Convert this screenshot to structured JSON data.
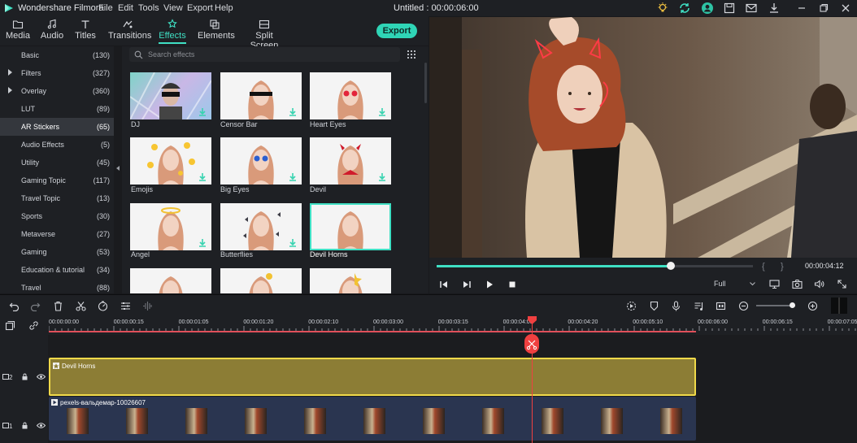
{
  "app": {
    "name": "Wondershare Filmora",
    "window_title": "Untitled : 00:00:06:00"
  },
  "menu": [
    "File",
    "Edit",
    "Tools",
    "View",
    "Export",
    "Help"
  ],
  "module_tabs": [
    {
      "label": "Media",
      "icon": "folder-icon"
    },
    {
      "label": "Audio",
      "icon": "music-note-icon"
    },
    {
      "label": "Titles",
      "icon": "text-icon"
    },
    {
      "label": "Transitions",
      "icon": "transition-icon"
    },
    {
      "label": "Effects",
      "icon": "effects-icon",
      "active": true
    },
    {
      "label": "Elements",
      "icon": "elements-icon"
    },
    {
      "label": "Split Screen",
      "icon": "split-screen-icon"
    }
  ],
  "export_label": "Export",
  "categories": [
    {
      "name": "Basic",
      "count": "(130)"
    },
    {
      "name": "Filters",
      "count": "(327)",
      "expandable": true
    },
    {
      "name": "Overlay",
      "count": "(360)",
      "expandable": true
    },
    {
      "name": "LUT",
      "count": "(89)"
    },
    {
      "name": "AR Stickers",
      "count": "(65)",
      "selected": true
    },
    {
      "name": "Audio Effects",
      "count": "(5)"
    },
    {
      "name": "Utility",
      "count": "(45)"
    },
    {
      "name": "Gaming Topic",
      "count": "(117)"
    },
    {
      "name": "Travel Topic",
      "count": "(13)"
    },
    {
      "name": "Sports",
      "count": "(30)"
    },
    {
      "name": "Metaverse",
      "count": "(27)"
    },
    {
      "name": "Gaming",
      "count": "(53)"
    },
    {
      "name": "Education & tutorial",
      "count": "(34)"
    },
    {
      "name": "Travel",
      "count": "(88)"
    }
  ],
  "search": {
    "placeholder": "Search effects"
  },
  "effects": [
    {
      "label": "DJ"
    },
    {
      "label": "Censor Bar"
    },
    {
      "label": "Heart Eyes"
    },
    {
      "label": "Emojis"
    },
    {
      "label": "Big Eyes"
    },
    {
      "label": "Devil"
    },
    {
      "label": "Angel"
    },
    {
      "label": "Butterflies"
    },
    {
      "label": "Devil Horns",
      "selected": true
    },
    {
      "label": ""
    },
    {
      "label": ""
    },
    {
      "label": ""
    }
  ],
  "preview": {
    "progress": 0.74,
    "time": "00:00:04:12",
    "zoom": "Full",
    "brace_open": "{",
    "brace_close": "}"
  },
  "ruler": {
    "labels": [
      "00:00:00:00",
      "00:00:00:15",
      "00:00:01:05",
      "00:00:01:20",
      "00:00:02:10",
      "00:00:03:00",
      "00:00:03:15",
      "00:00:04:05",
      "00:00:04:20",
      "00:00:05:10",
      "00:00:06:00",
      "00:00:06:15",
      "00:00:07:05"
    ]
  },
  "tracks": {
    "track2_number": "2",
    "track1_number": "1",
    "effect_clip": "Devil Horns",
    "video_clip": "pexels-вальдемар-10026607"
  },
  "colors": {
    "accent": "#3fe0c4",
    "playhead": "#f04040",
    "effect_clip": "#8c7d35",
    "effect_clip_border": "#f0d94a",
    "video_clip": "#2a3550"
  }
}
